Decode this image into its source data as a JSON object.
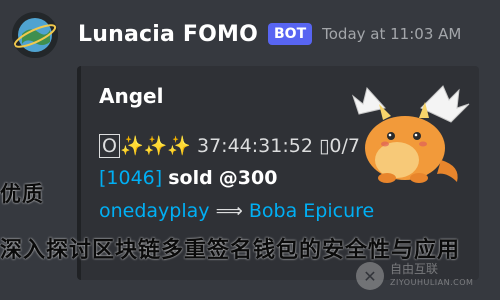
{
  "message": {
    "username": "Lunacia FOMO",
    "badge": "BOT",
    "timestamp": "Today at 11:03 AM"
  },
  "embed": {
    "title": "Angel",
    "line1": "[O✨✨✨] 37:44:31:52 [0/7",
    "line1_prefix": "O",
    "line1_stars": "✨✨✨",
    "line1_rest": "37:44:31:52 ▯0/7",
    "line2_id": "[1046]",
    "line2_action": "sold",
    "line2_price": "@300",
    "line3_from": "onedayplay",
    "line3_arrow": "⟹",
    "line3_to": "Boba Epicure"
  },
  "overlay": {
    "line1": "优质",
    "line2": "深入探讨区块链多重签名钱包的安全性与应用"
  },
  "watermark": {
    "chinese": "自由互联",
    "english": "ZIYOUHULIAN.COM"
  },
  "colors": {
    "background": "#36393f",
    "embed_bg": "#2f3136",
    "badge": "#5865f2",
    "link": "#00aff4"
  }
}
